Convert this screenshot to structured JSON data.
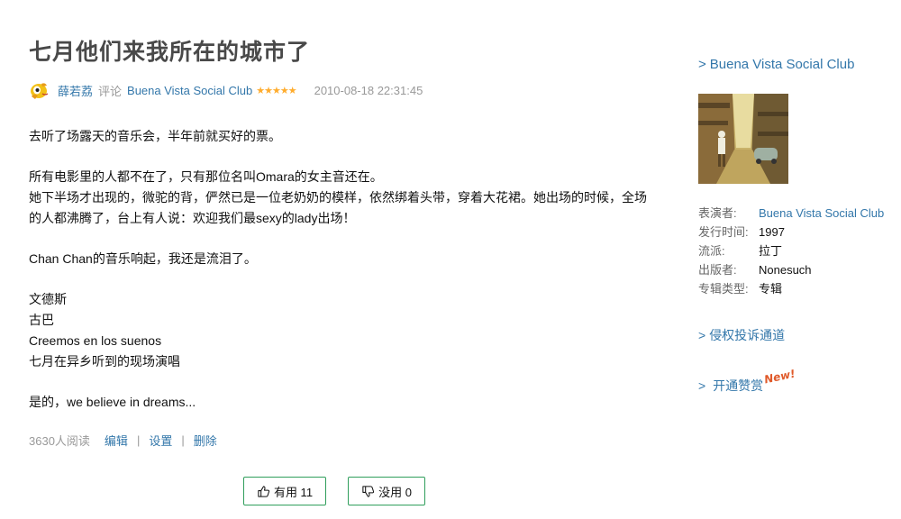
{
  "review": {
    "title": "七月他们来我所在的城市了",
    "author": "薛若荔",
    "verb": "评论",
    "subject": "Buena Vista Social Club",
    "rating_stars": "★★★★★",
    "rating": 5,
    "date": "2010-08-18 22:31:45",
    "paragraphs": [
      [
        "去听了场露天的音乐会，半年前就买好的票。"
      ],
      [
        "所有电影里的人都不在了，只有那位名叫Omara的女主音还在。",
        "她下半场才出现的，微驼的背，俨然已是一位老奶奶的模样，依然绑着头带，穿着大花裙。她出场的时候，全场的人都沸腾了，台上有人说：欢迎我们最sexy的lady出场！"
      ],
      [
        "Chan Chan的音乐响起，我还是流泪了。"
      ],
      [
        "文德斯",
        "古巴",
        "Creemos en los suenos",
        "七月在异乡听到的现场演唱"
      ],
      [
        "是的，we believe in dreams..."
      ]
    ],
    "reads": "3630人阅读",
    "actions": [
      "编辑",
      "设置",
      "删除"
    ],
    "useful_label": "有用 11",
    "useless_label": "没用 0"
  },
  "sidebar": {
    "album_link": "Buena Vista Social Club",
    "arrow": ">",
    "info": [
      {
        "key": "表演者:",
        "value": "Buena Vista Social Club",
        "link": true
      },
      {
        "key": "发行时间:",
        "value": "1997",
        "link": false
      },
      {
        "key": "流派:",
        "value": "拉丁",
        "link": false
      },
      {
        "key": "出版者:",
        "value": "Nonesuch",
        "link": false
      },
      {
        "key": "专辑类型:",
        "value": "专辑",
        "link": false
      }
    ],
    "report_link": "侵权投诉通道",
    "reward_link": "开通赞赏",
    "new_tag": "New!"
  },
  "colors": {
    "link": "#3377aa",
    "star": "#ffac2d",
    "vote_border": "#2f9e5b",
    "title": "#494949"
  }
}
